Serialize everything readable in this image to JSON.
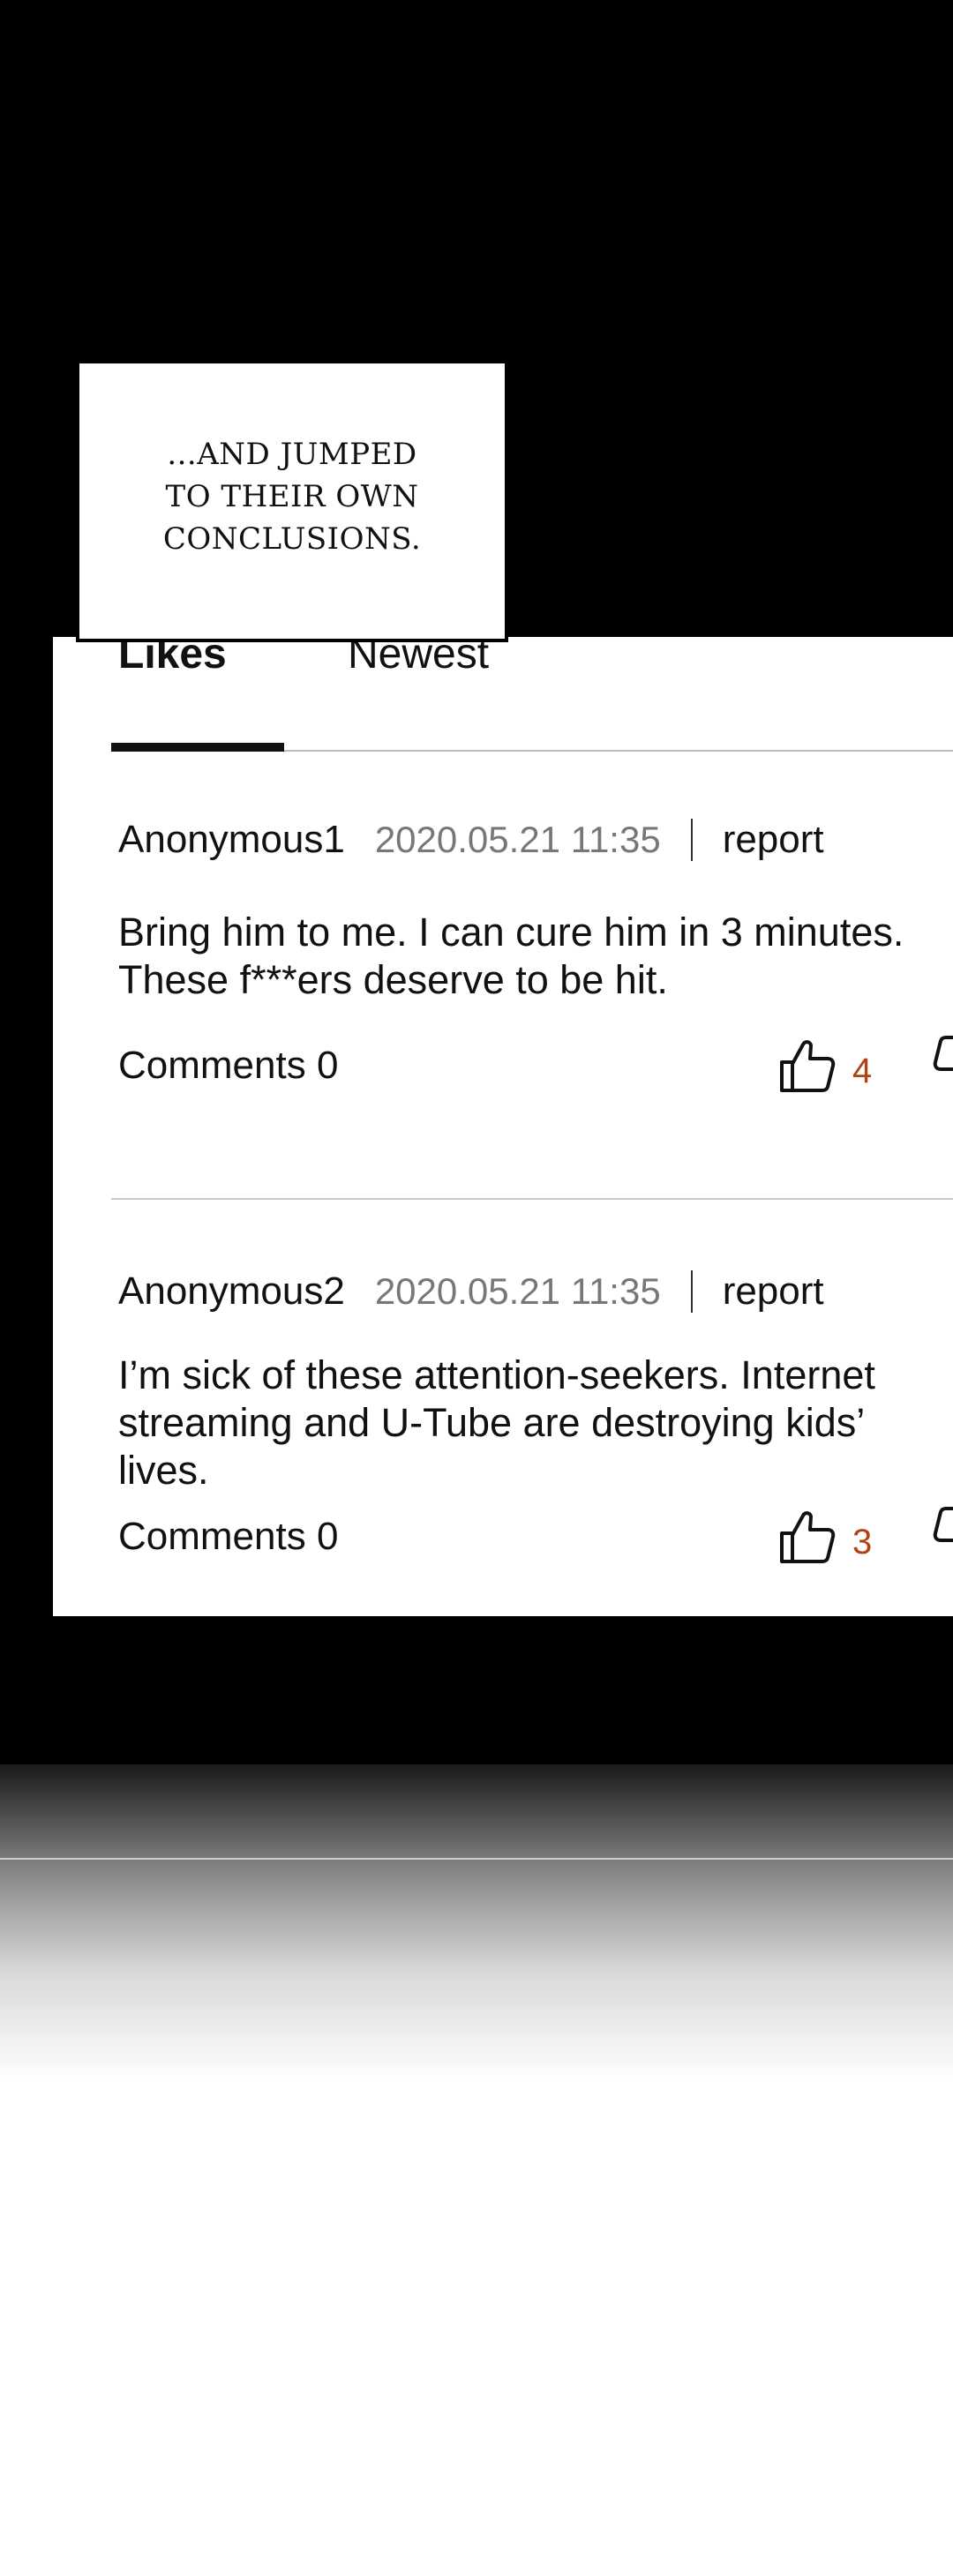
{
  "caption": {
    "lines": [
      "...AND JUMPED",
      "TO THEIR OWN",
      "CONCLUSIONS."
    ]
  },
  "tabs": {
    "likes": "Likes",
    "newest": "Newest"
  },
  "comments": [
    {
      "user": "Anonymous1",
      "time": "2020.05.21 11:35",
      "report": "report",
      "body": "Bring him to me. I can cure him in 3 minutes. These f***ers deserve to be hit.",
      "comments_count": "Comments 0",
      "likes": "4"
    },
    {
      "user": "Anonymous2",
      "time": "2020.05.21 11:35",
      "report": "report",
      "body": "I’m sick of these attention-seekers. Internet streaming and U-Tube are destroying kids’ lives.",
      "comments_count": "Comments 0",
      "likes": "3"
    }
  ],
  "icons": {
    "like": "thumbs-up-icon",
    "dislike": "thumbs-down-icon"
  },
  "colors": {
    "like_count": "#b4410f",
    "background_top": "#000000"
  }
}
